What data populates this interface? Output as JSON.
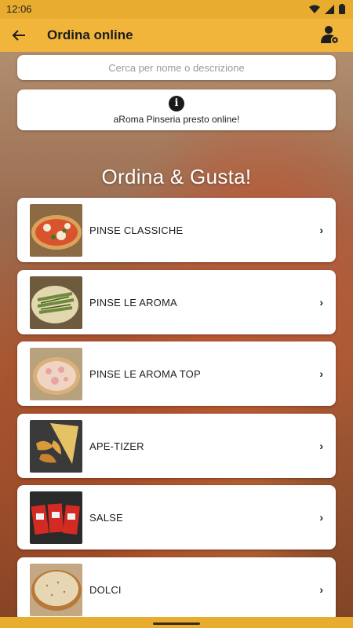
{
  "status_bar": {
    "time": "12:06"
  },
  "app_bar": {
    "title": "Ordina online",
    "back_icon": "arrow-left-icon",
    "user_icon": "user-settings-icon"
  },
  "search": {
    "placeholder": "Cerca per nome o descrizione"
  },
  "info": {
    "icon": "info-icon",
    "text": "aRoma Pinseria presto online!"
  },
  "hero": {
    "title": "Ordina & Gusta!"
  },
  "categories": [
    {
      "label": "PINSE CLASSICHE",
      "image": "pinsa-margherita-photo"
    },
    {
      "label": "PINSE LE AROMA",
      "image": "pinsa-zucchini-photo"
    },
    {
      "label": "PINSE LE AROMA TOP",
      "image": "pinsa-ham-photo"
    },
    {
      "label": "APE-TIZER",
      "image": "potato-wedges-photo"
    },
    {
      "label": "SALSE",
      "image": "ketchup-packets-photo"
    },
    {
      "label": "DOLCI",
      "image": "dessert-pie-photo"
    }
  ],
  "chevron": "›",
  "colors": {
    "accent": "#f1b53c",
    "status": "#e8ac2e",
    "card": "#ffffff"
  }
}
